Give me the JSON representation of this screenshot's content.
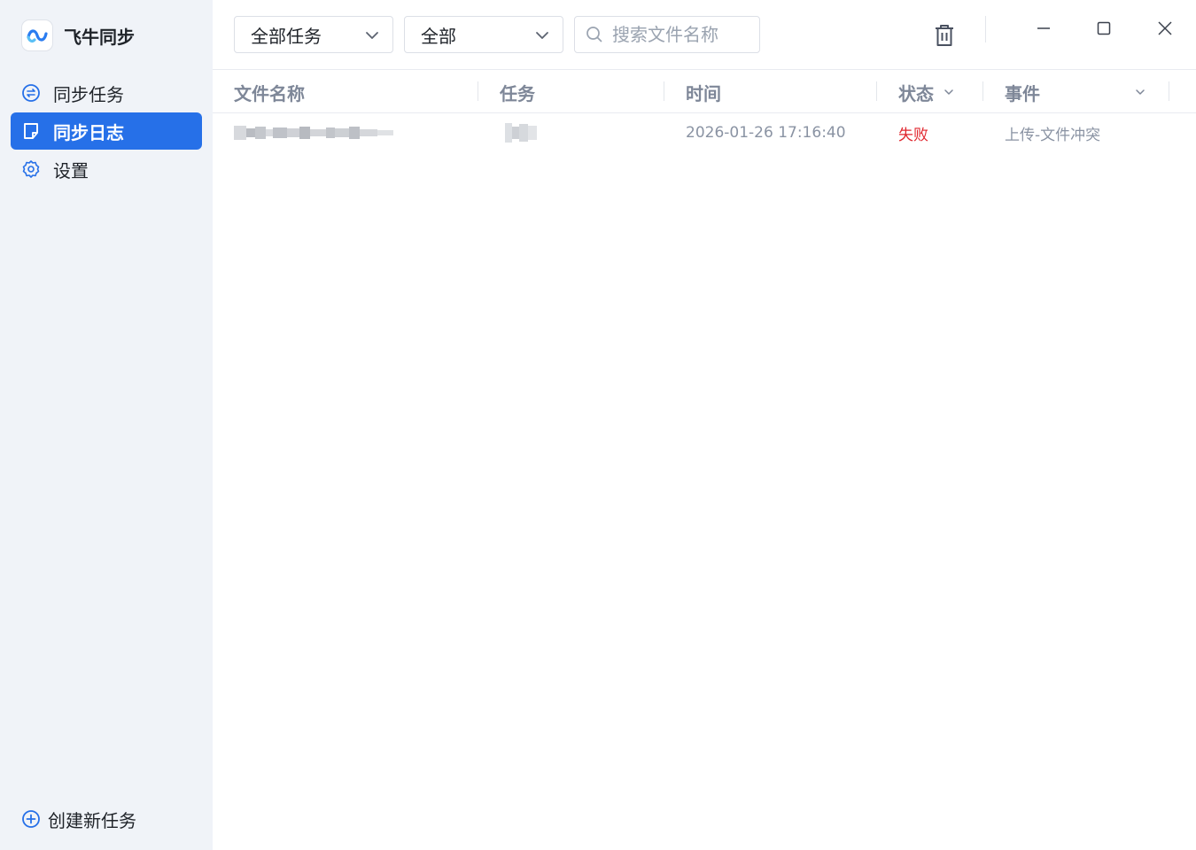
{
  "app": {
    "name": "飞牛同步"
  },
  "sidebar": {
    "items": [
      {
        "label": "同步任务",
        "icon": "sync-circle-icon",
        "active": false
      },
      {
        "label": "同步日志",
        "icon": "log-note-icon",
        "active": true
      },
      {
        "label": "设置",
        "icon": "gear-icon",
        "active": false
      }
    ],
    "create_label": "创建新任务"
  },
  "toolbar": {
    "task_filter": "全部任务",
    "status_filter": "全部",
    "search_placeholder": "搜索文件名称"
  },
  "table": {
    "columns": [
      "文件名称",
      "任务",
      "时间",
      "状态",
      "事件"
    ],
    "rows": [
      {
        "filename": "",
        "task": "",
        "time": "2026-01-26 17:16:40",
        "status": "失败",
        "event": "上传-文件冲突"
      }
    ]
  },
  "colors": {
    "accent": "#2670e8",
    "fail": "#e0262e",
    "sidebar_bg": "#f0f3f8"
  }
}
